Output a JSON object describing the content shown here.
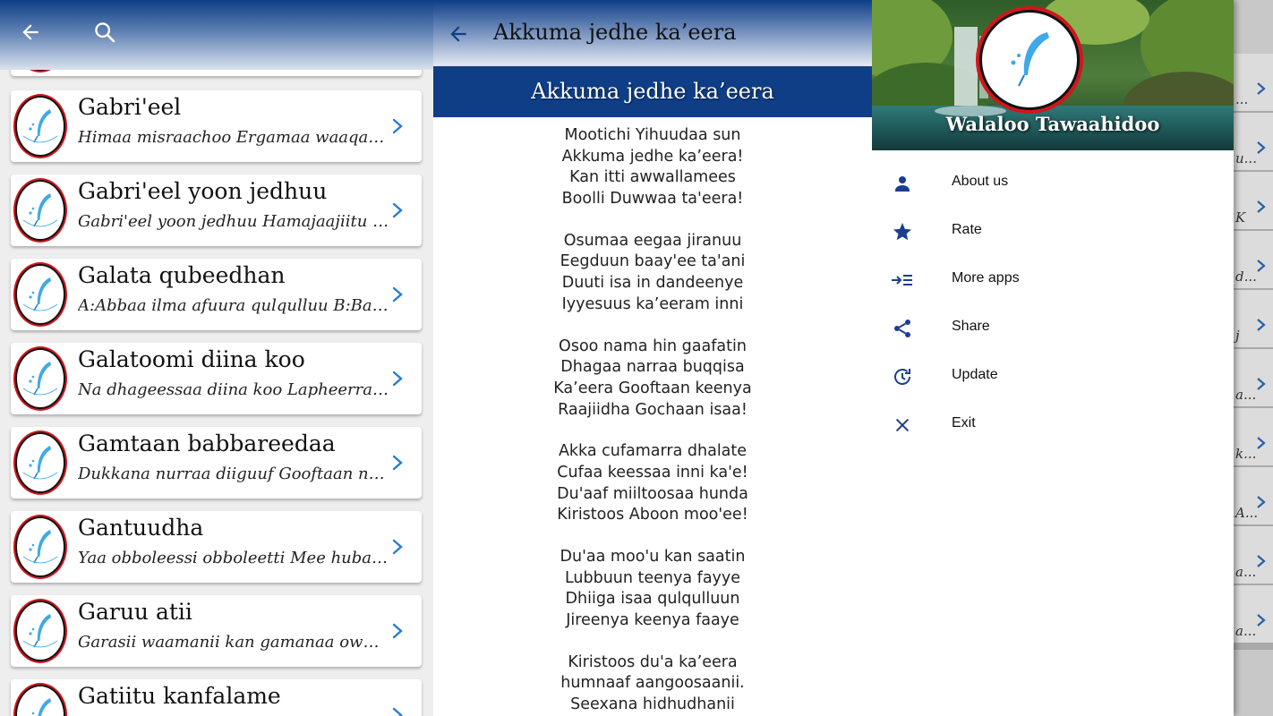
{
  "colors": {
    "primary": "#0f3e87",
    "accent_icon": "#1a3f8f",
    "chevron": "#2a7bd6",
    "logo_ring": "#d1161d"
  },
  "list_panel": {
    "back_icon": "arrow-left",
    "search_icon": "magnifier",
    "logo_ring_text": "WALALOO TAWAAHIDOO",
    "songs": [
      {
        "title": "Gabri'eel",
        "subtitle": "Himaa misraachoo Ergamaa waaqa Tajaajilaa"
      },
      {
        "title": "Gabri'eel yoon jedhuu",
        "subtitle": "Gabri'eel yoon jedhuu Hamajaajiitu dhiphate"
      },
      {
        "title": "Galata qubeedhan",
        "subtitle": "A:Abbaa ilma afuura qulqulluu B:Barreessaa"
      },
      {
        "title": "Galatoomi diina koo",
        "subtitle": "Na dhageessaa diina koo Lapheerran sin dhiisa"
      },
      {
        "title": "Gamtaan babbareedaa",
        "subtitle": "Dukkana nurraa diiguuf Gooftaan nuuf dhufe"
      },
      {
        "title": "Gantuudha",
        "subtitle": "Yaa obboleessi obboleetti Mee hubadhu amma"
      },
      {
        "title": "Garuu atii",
        "subtitle": "Garasii waamanii kan gamanaa owwaatanii"
      },
      {
        "title": "Gatiitu kanfalame",
        "subtitle": ""
      }
    ]
  },
  "lyrics_panel": {
    "title": "Akkuma jedhe ka’eera",
    "banner": "Akkuma jedhe ka’eera",
    "stanzas": [
      [
        "Mootichi Yihuudaa sun",
        "Akkuma jedhe ka’eera!",
        "Kan itti awwallamees",
        "Boolli Duwwaa ta'eera!"
      ],
      [
        "Osumaa eegaa jiranuu",
        "Eegduun baay'ee ta'ani",
        "Duuti isa in dandeenye",
        "Iyyesuus ka’eeram inni"
      ],
      [
        "Osoo nama hin gaafatin",
        "Dhagaa narraa buqqisa",
        "Ka’eera Gooftaan keenya",
        "Raajiidha Gochaan isaa!"
      ],
      [
        "Akka cufamarra dhalate",
        "Cufaa keessaa inni ka'e!",
        "Du'aaf miiltoosaa hunda",
        "Kiristoos Aboon moo'ee!"
      ],
      [
        "Du'aa moo'u kan saatin",
        "Lubbuun teenya fayye",
        "Dhiiga isaa qulqulluun",
        "Jireenya keenya faaye"
      ],
      [
        "Kiristoos du'a ka’eera",
        "humnaaf aangoosaanii.",
        "Seexana hidhudhanii"
      ]
    ]
  },
  "drawer_panel": {
    "header_title": "Walaloo Tawaahidoo",
    "menu": [
      {
        "label": "About us",
        "icon": "person-icon"
      },
      {
        "label": "Rate",
        "icon": "star-icon"
      },
      {
        "label": "More apps",
        "icon": "indent-icon"
      },
      {
        "label": "Share",
        "icon": "share-icon"
      },
      {
        "label": "Update",
        "icon": "update-icon"
      },
      {
        "label": "Exit",
        "icon": "close-icon"
      }
    ],
    "behind_fragments": [
      "...",
      "u...",
      "K",
      "d...",
      "j",
      "a...",
      "k...",
      "A...",
      "a...",
      "a..."
    ]
  }
}
